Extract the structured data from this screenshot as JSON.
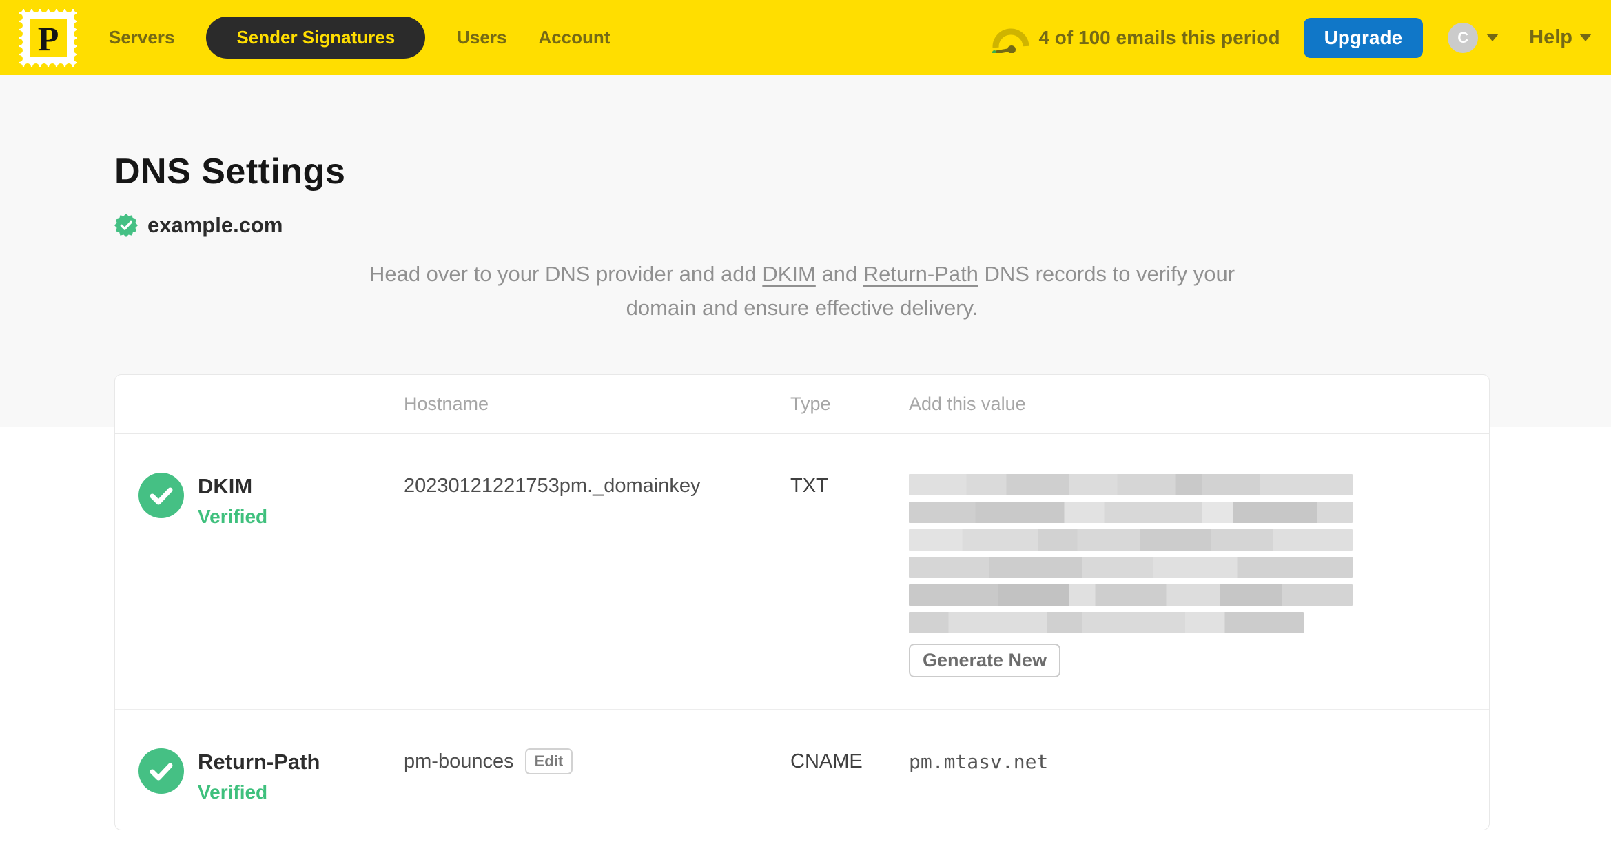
{
  "header": {
    "logo_letter": "P",
    "nav": [
      {
        "label": "Servers",
        "active": false
      },
      {
        "label": "Sender Signatures",
        "active": true
      },
      {
        "label": "Users",
        "active": false
      },
      {
        "label": "Account",
        "active": false
      }
    ],
    "usage_text": "4 of 100 emails this period",
    "upgrade_label": "Upgrade",
    "avatar_initial": "C",
    "help_label": "Help"
  },
  "page": {
    "title": "DNS Settings",
    "domain": "example.com",
    "intro_part1": "Head over to your DNS provider and add ",
    "intro_link1": "DKIM",
    "intro_part2": " and ",
    "intro_link2": "Return-Path",
    "intro_part3": " DNS records to verify your domain and ensure effective delivery."
  },
  "table": {
    "columns": [
      "Hostname",
      "Type",
      "Add this value"
    ],
    "rows": [
      {
        "name": "DKIM",
        "status": "Verified",
        "hostname": "20230121221753pm._domainkey",
        "type": "TXT",
        "value_redacted": true,
        "action_label": "Generate New"
      },
      {
        "name": "Return-Path",
        "status": "Verified",
        "hostname": "pm-bounces",
        "edit_label": "Edit",
        "type": "CNAME",
        "value": "pm.mtasv.net"
      }
    ]
  },
  "colors": {
    "brand_yellow": "#ffde00",
    "nav_text_olive": "#756a15",
    "active_pill_bg": "#2b2b2b",
    "upgrade_blue": "#1077c8",
    "verified_green": "#3fc07d",
    "check_circle_green": "#45c084"
  }
}
